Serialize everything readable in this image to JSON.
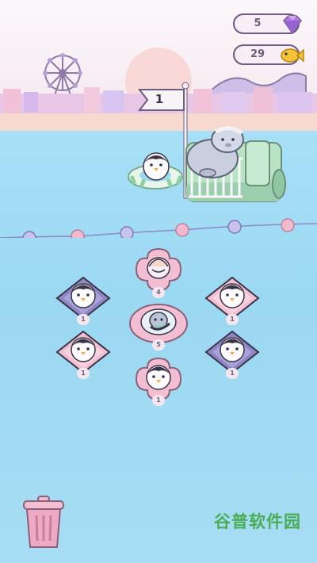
{
  "hud": {
    "gems": "5",
    "fish": "29"
  },
  "stage": {
    "flag_number": "1"
  },
  "slots": [
    {
      "name": "slot-top-flower",
      "level": "4"
    },
    {
      "name": "slot-left-upper",
      "level": "1"
    },
    {
      "name": "slot-right-upper",
      "level": "1"
    },
    {
      "name": "slot-center-ring",
      "level": "5"
    },
    {
      "name": "slot-left-lower",
      "level": "1"
    },
    {
      "name": "slot-right-lower",
      "level": "1"
    },
    {
      "name": "slot-bottom-flower",
      "level": "1"
    }
  ],
  "icons": {
    "gem": "purple-gem-icon",
    "fish": "gold-fish-icon",
    "trash": "trash-can-icon"
  },
  "colors": {
    "sea": "#9fdaf3",
    "outline": "#6e5c7f",
    "pink": "#f0b6cb",
    "purple": "#8f87c6",
    "mint": "#b9e3c5"
  },
  "watermark": "谷普软件园"
}
